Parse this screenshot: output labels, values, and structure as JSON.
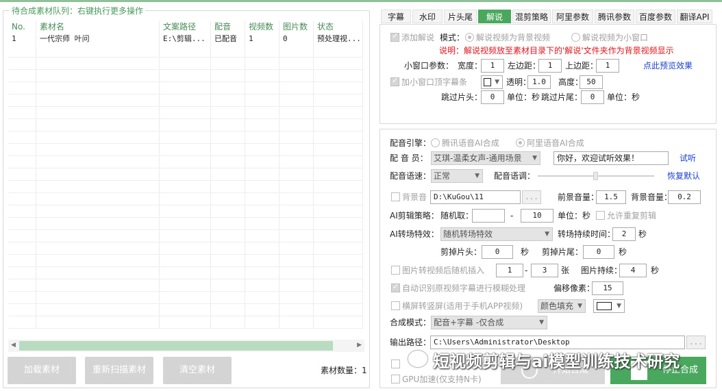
{
  "queue": {
    "title": "待合成素材队列：右键执行更多操作",
    "columns": [
      "No.",
      "素材名",
      "文案路径",
      "配音",
      "视频数",
      "图片数",
      "状态"
    ],
    "rows": [
      [
        "1",
        "一代宗师 叶问",
        "E:\\剪辑...",
        "已配音",
        "1",
        "0",
        "预处理视..."
      ]
    ],
    "count_label": "素材数量：1",
    "buttons": {
      "load": "加载素材",
      "rescan": "重新扫描素材",
      "clear": "清空素材"
    }
  },
  "tabs": [
    "字幕",
    "水印",
    "片头尾",
    "解说",
    "混剪策略",
    "阿里参数",
    "腾讯参数",
    "百度参数",
    "翻译API"
  ],
  "narration": {
    "add_label": "添加解说",
    "mode_label": "模式：",
    "mode_bg": "解说视频为背景视频",
    "mode_small": "解说视频为小窗口",
    "note": "说明：解说视频放至素材目录下的'解说'文件夹作为背景视频显示",
    "small_params_label": "小窗口参数：",
    "width_label": "宽度：",
    "width": "1",
    "left_label": "左边距：",
    "left": "1",
    "top_label": "上边距：",
    "top": "1",
    "preview_link": "点此预览效果",
    "topbar_label": "加小窗口顶字幕条",
    "alpha_label": "透明：",
    "alpha": "1.0",
    "height_label": "高度：",
    "height": "50",
    "skip_head_label": "跳过片头：",
    "skip_head": "0",
    "unit_sec_1": "单位：秒",
    "skip_tail_label": "跳过片尾：",
    "skip_tail": "0",
    "unit_sec_2": "单位：秒"
  },
  "dubbing": {
    "engine_label": "配音引擎：",
    "engine_tencent": "腾讯语音AI合成",
    "engine_ali": "阿里语音AI合成",
    "voice_label": "配 音 员：",
    "voice_value": "艾琪-温柔女声-通用场景",
    "test_text": "你好，欢迎试听效果！",
    "listen_link": "试听",
    "speed_label": "配音语速：",
    "speed_value": "正常",
    "pitch_label": "配音语调：",
    "reset_link": "恢复默认",
    "bgm_label": "背景音",
    "bgm_path": "D:\\KuGou\\11",
    "browse": "...",
    "fg_vol_label": "前景音量：",
    "fg_vol": "1.5",
    "bg_vol_label": "背景音量：",
    "bg_vol": "0.2",
    "ai_strategy_label": "AI剪辑策略：",
    "random_label": "随机取：",
    "dash": "-",
    "random_max": "10",
    "unit_sec": "单位：秒",
    "allow_repeat": "允许重复剪辑",
    "transition_label": "AI转场特效：",
    "transition_value": "随机转场特效",
    "transition_dur_label": "转场持续时间：",
    "transition_dur": "2",
    "sec": "秒",
    "cut_head_label": "剪掉片头：",
    "cut_head": "0",
    "cut_tail_label": "剪掉片尾：",
    "cut_tail": "0",
    "img_insert_label": "图片转视频后随机插入",
    "img_min": "1",
    "img_max": "3",
    "zhang": "张",
    "img_dur_label": "图片持续：",
    "img_dur": "4",
    "auto_blur_label": "自动识别原视频字幕进行模糊处理",
    "offset_label": "偏移像素：",
    "offset": "15",
    "landscape_label": "横屏转竖屏(适用于手机APP视频)",
    "fill_value": "颜色填充",
    "compose_mode_label": "合成模式：",
    "compose_mode_value": "配音+字幕 -仅合成",
    "output_label": "输出路径：",
    "output_path": "C:\\Users\\Administrator\\Desktop",
    "gpu_label": "GPU加速(仅支持N卡)",
    "start_button": "开始合成",
    "stop_button": "停止合成"
  },
  "watermark_text": "短视频剪辑与ai模型训练技术研究",
  "colors": {
    "accent": "#4aa85e",
    "link": "#1a3fd0",
    "warn": "#e0161c"
  }
}
